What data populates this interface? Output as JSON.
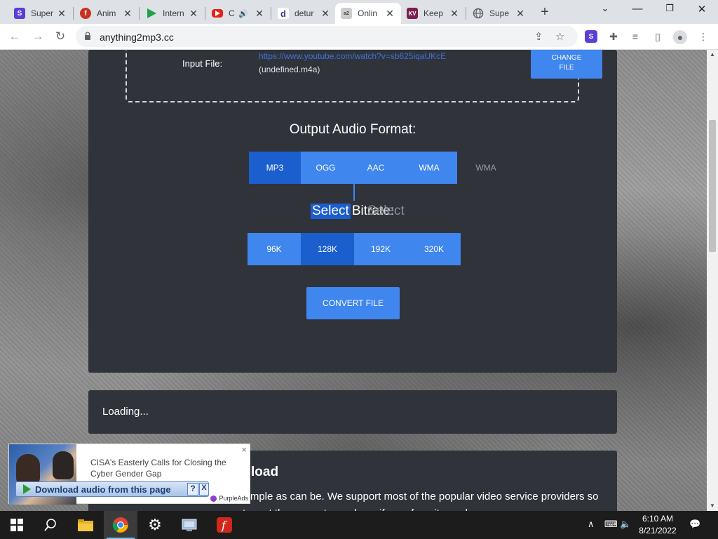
{
  "browser": {
    "tabs": [
      {
        "label": "Super",
        "icon": "s-logo-icon",
        "color": "#5b3fd6"
      },
      {
        "label": "Anim",
        "icon": "flash-icon",
        "color": "#c8321e"
      },
      {
        "label": "Intern",
        "icon": "play-arrow-icon",
        "color": "#1ea446"
      },
      {
        "label": "C",
        "icon": "youtube-icon",
        "color": "#e62117"
      },
      {
        "label": "detur",
        "icon": "d-logo-icon",
        "color": "#2a3b8f"
      },
      {
        "label": "Onlin",
        "icon": "anything2mp3-icon",
        "color": "#888888"
      },
      {
        "label": "Keep",
        "icon": "kv-logo-icon",
        "color": "#7a1f4f"
      },
      {
        "label": "Supe",
        "icon": "globe-icon",
        "color": "#5f6368"
      }
    ],
    "url": "anything2mp3.cc"
  },
  "converter": {
    "input_label": "Input File:",
    "input_url": "https://www.youtube.com/watch?v=sb625iqaUKcE",
    "input_name": "(undefined.m4a)",
    "change_button": "CHANGE FILE",
    "output_title": "Output Audio Format:",
    "formats": [
      {
        "label": "MP3"
      },
      {
        "label": "OGG"
      },
      {
        "label": "AAC"
      },
      {
        "label": "WMA"
      }
    ],
    "format_ghost": "WMA",
    "bitrate_title_a": "Select",
    "bitrate_title_b": "Bitrate:",
    "bitrate_ghost": "Select",
    "bitrates": [
      "96K",
      "128K",
      "192K",
      "320K"
    ],
    "convert_button": "CONVERT FILE"
  },
  "status": {
    "loading": "Loading..."
  },
  "howto": {
    "title_suffix": "load",
    "text": "simple as can be. We support most of the popular video service providers so try out the converter and see if your favorite works"
  },
  "ad": {
    "headline": "CISA's Easterly Calls for Closing the Cyber Gender Gap",
    "brand": "PurpleAds",
    "download_label": "Download audio from this page",
    "help": "?",
    "close": "X"
  },
  "taskbar": {
    "time": "6:10 AM",
    "date": "8/21/2022"
  }
}
